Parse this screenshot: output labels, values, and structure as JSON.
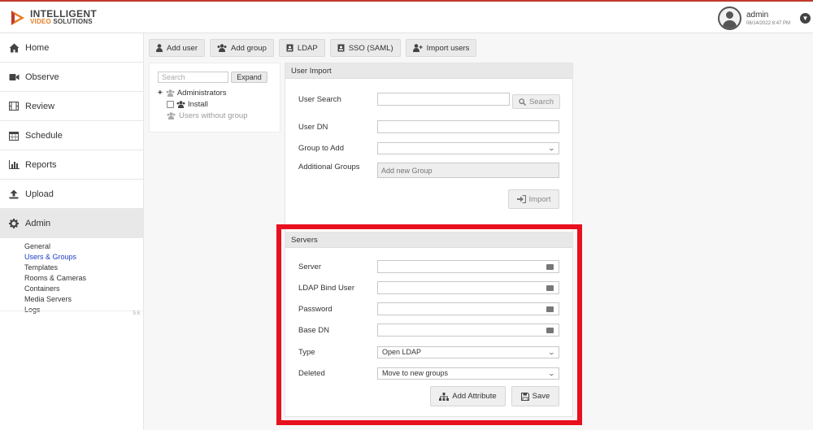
{
  "brand": {
    "line1": "INTELLIGENT",
    "line2_accent": "VIDEO",
    "line2_rest": "SOLUTIONS",
    "accent_color": "#e67e22"
  },
  "user": {
    "name": "admin",
    "date": "06/14/2022 8:47 PM",
    "menu_icon": "chevron-down-icon"
  },
  "nav": {
    "items": [
      {
        "label": "Home",
        "icon": "home-icon"
      },
      {
        "label": "Observe",
        "icon": "video-camera-icon"
      },
      {
        "label": "Review",
        "icon": "film-icon"
      },
      {
        "label": "Schedule",
        "icon": "calendar-icon"
      },
      {
        "label": "Reports",
        "icon": "bar-chart-icon"
      },
      {
        "label": "Upload",
        "icon": "upload-icon"
      },
      {
        "label": "Admin",
        "icon": "gear-icon"
      }
    ],
    "admin_subitems": [
      "General",
      "Users & Groups",
      "Templates",
      "Rooms & Cameras",
      "Containers",
      "Media Servers",
      "Logs"
    ],
    "current_subitem": "Users & Groups",
    "version": "5.6"
  },
  "toolbar": {
    "add_user": "Add user",
    "add_group": "Add group",
    "ldap": "LDAP",
    "sso": "SSO (SAML)",
    "import_users": "Import users"
  },
  "tree": {
    "search_placeholder": "Search",
    "expand_label": "Expand",
    "nodes": {
      "administrators": "Administrators",
      "install": "Install",
      "users_without_group": "Users without group"
    }
  },
  "user_import": {
    "title": "User Import",
    "user_search_label": "User Search",
    "user_search_value": "",
    "search_button": "Search",
    "user_dn_label": "User DN",
    "user_dn_value": "",
    "group_to_add_label": "Group to Add",
    "group_to_add_value": "",
    "additional_groups_label": "Additional Groups",
    "additional_groups_placeholder": "Add new Group",
    "import_button": "Import"
  },
  "servers": {
    "title": "Servers",
    "server_label": "Server",
    "server_value": "",
    "bind_user_label": "LDAP Bind User",
    "bind_user_value": "",
    "password_label": "Password",
    "password_value": "",
    "base_dn_label": "Base DN",
    "base_dn_value": "",
    "type_label": "Type",
    "type_value": "Open LDAP",
    "deleted_label": "Deleted",
    "deleted_value": "Move to new groups",
    "add_attribute_button": "Add Attribute",
    "save_button": "Save"
  },
  "colors": {
    "highlight_border": "#e8101e",
    "active_link": "#1a3cc8",
    "top_rule": "#c0392b"
  }
}
